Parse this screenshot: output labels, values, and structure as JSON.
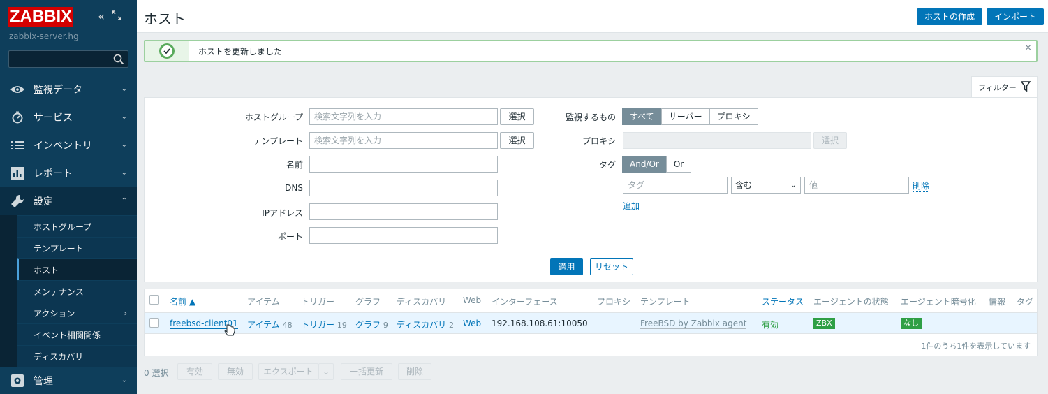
{
  "sidebar": {
    "logo": "ZABBIX",
    "server_name": "zabbix-server.hg",
    "menu": [
      {
        "label": "監視データ",
        "icon": "eye-icon"
      },
      {
        "label": "サービス",
        "icon": "stopwatch-icon"
      },
      {
        "label": "インベントリ",
        "icon": "list-icon"
      },
      {
        "label": "レポート",
        "icon": "bar-chart-icon"
      },
      {
        "label": "設定",
        "icon": "wrench-icon"
      },
      {
        "label": "管理",
        "icon": "cog-icon"
      }
    ],
    "submenu": [
      "ホストグループ",
      "テンプレート",
      "ホスト",
      "メンテナンス",
      "アクション",
      "イベント相関関係",
      "ディスカバリ"
    ]
  },
  "header": {
    "title": "ホスト",
    "create_button": "ホストの作成",
    "import_button": "インポート"
  },
  "message": {
    "text": "ホストを更新しました",
    "close": "×"
  },
  "filter": {
    "tab_label": "フィルター",
    "host_group_label": "ホストグループ",
    "host_group_placeholder": "検索文字列を入力",
    "template_label": "テンプレート",
    "template_placeholder": "検索文字列を入力",
    "select_button": "選択",
    "name_label": "名前",
    "dns_label": "DNS",
    "ip_label": "IPアドレス",
    "port_label": "ポート",
    "monitored_by_label": "監視するもの",
    "monitored_by_options": [
      "すべて",
      "サーバー",
      "プロキシ"
    ],
    "proxy_label": "プロキシ",
    "tag_label": "タグ",
    "tag_mode_options": [
      "And/Or",
      "Or"
    ],
    "tag_placeholder": "タグ",
    "tag_operator": "含む",
    "value_placeholder": "値",
    "remove_link": "削除",
    "add_link": "追加",
    "apply_button": "適用",
    "reset_button": "リセット"
  },
  "table": {
    "headers": {
      "name": "名前 ▲",
      "items": "アイテム",
      "triggers": "トリガー",
      "graphs": "グラフ",
      "discovery": "ディスカバリ",
      "web": "Web",
      "interface": "インターフェース",
      "proxy": "プロキシ",
      "templates": "テンプレート",
      "status": "ステータス",
      "agent_status": "エージェントの状態",
      "agent_encryption": "エージェント暗号化",
      "info": "情報",
      "tags": "タグ"
    },
    "row": {
      "name": "freebsd-client01",
      "items": "アイテム",
      "items_count": "48",
      "triggers": "トリガー",
      "triggers_count": "19",
      "graphs": "グラフ",
      "graphs_count": "9",
      "discovery": "ディスカバリ",
      "discovery_count": "2",
      "web": "Web",
      "interface": "192.168.108.61:10050",
      "template": "FreeBSD by Zabbix agent",
      "status": "有効",
      "agent_badge": "ZBX",
      "encryption_badge": "なし"
    },
    "footer": "1件のうち1件を表示しています"
  },
  "bottom_bar": {
    "selected": "0 選択",
    "enable": "有効",
    "disable": "無効",
    "export": "エクスポート",
    "mass_update": "一括更新",
    "delete": "削除"
  }
}
